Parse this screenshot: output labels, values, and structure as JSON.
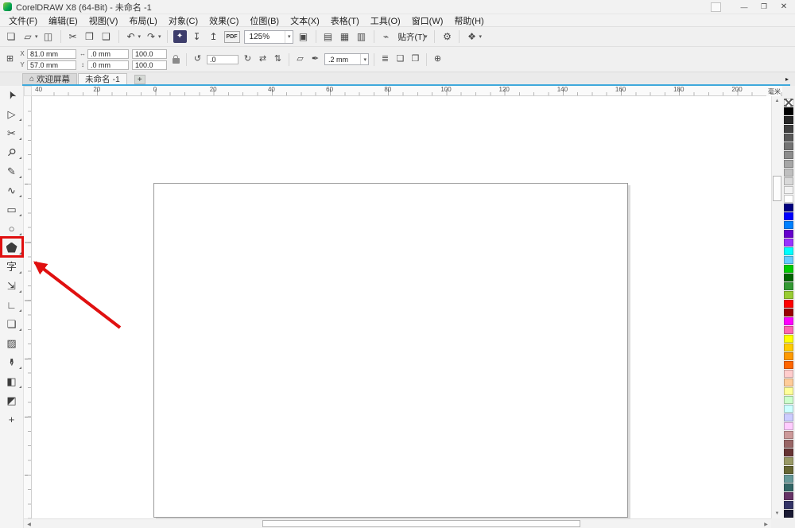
{
  "titlebar": {
    "title": "CorelDRAW X8 (64-Bit) - 未命名 -1",
    "window_buttons": {
      "minimize": "—",
      "restore": "❐",
      "close": "✕"
    }
  },
  "menubar": {
    "items": [
      "文件(F)",
      "编辑(E)",
      "视图(V)",
      "布局(L)",
      "对象(C)",
      "效果(C)",
      "位图(B)",
      "文本(X)",
      "表格(T)",
      "工具(O)",
      "窗口(W)",
      "帮助(H)"
    ]
  },
  "toolbar": {
    "zoom_level": "125%",
    "pdf_label": "PDF",
    "snap_label": "贴齐(T)",
    "icons": {
      "new": "❏",
      "open": "▱",
      "save": "◫",
      "cut": "✂",
      "copy": "❒",
      "paste": "❑",
      "undo": "↶",
      "redo": "↷",
      "search": "✦",
      "import": "↧",
      "export": "↥",
      "fullscreen": "▣",
      "rulers": "▤",
      "grid": "▦",
      "guidelines": "▥",
      "snap": "⌁",
      "gear": "⚙",
      "launcher": "❖",
      "caret": "▾"
    }
  },
  "property_bar": {
    "position_x": "81.0 mm",
    "position_y": "57.0 mm",
    "size_w": ".0 mm",
    "size_h": ".0 mm",
    "scale_h": "100.0",
    "scale_v": "100.0",
    "rotation": ".0",
    "outline_width": ".2 mm",
    "icons": {
      "grid": "⊞",
      "label_x": "X",
      "label_y": "Y",
      "width": "↔",
      "height": "↕",
      "rotate": "↺",
      "dial": "↻",
      "mirror_h": "⇄",
      "mirror_v": "⇅",
      "shape": "▱",
      "pen": "✒",
      "wrap": "≣",
      "front": "❏",
      "back": "❐",
      "plus": "⊕",
      "caret": "▾"
    }
  },
  "tabbar": {
    "tabs": [
      {
        "name": "tab-welcome",
        "label": "欢迎屏幕",
        "icon": "⌂",
        "active": false
      },
      {
        "name": "tab-untitled-1",
        "label": "未命名 -1",
        "active": true
      }
    ],
    "new_tab_label": "+",
    "scroll_arrow": "▸"
  },
  "rulers": {
    "horizontal_labels": [
      "40",
      "20",
      "0",
      "20",
      "40",
      "60",
      "80",
      "100",
      "120",
      "140",
      "160",
      "180",
      "200"
    ],
    "unit": "毫米"
  },
  "toolbox": {
    "tools": [
      {
        "name": "pick-tool",
        "glyph": "➤",
        "cls": "rot-up",
        "flyout": false
      },
      {
        "name": "shape-tool",
        "glyph": "▷",
        "flyout": true
      },
      {
        "name": "crop-tool",
        "glyph": "✂",
        "flyout": true
      },
      {
        "name": "zoom-tool",
        "glyph": "⚲",
        "cls": "rot45",
        "flyout": true
      },
      {
        "name": "freehand-tool",
        "glyph": "✎",
        "flyout": true
      },
      {
        "name": "artistic-media-tool",
        "glyph": "∿",
        "flyout": true
      },
      {
        "name": "rectangle-tool",
        "glyph": "▭",
        "flyout": true
      },
      {
        "name": "ellipse-tool",
        "glyph": "○",
        "flyout": true
      },
      {
        "name": "polygon-tool",
        "shape": "pentagon",
        "flyout": true
      },
      {
        "name": "text-tool",
        "glyph": "字",
        "flyout": true
      },
      {
        "name": "parallel-dimension-tool",
        "glyph": "⇲",
        "flyout": true
      },
      {
        "name": "connector-tool",
        "glyph": "∟",
        "flyout": true
      },
      {
        "name": "drop-shadow-tool",
        "glyph": "❏",
        "flyout": true
      },
      {
        "name": "transparency-tool",
        "glyph": "▨",
        "flyout": false
      },
      {
        "name": "color-eyedropper-tool",
        "glyph": "✒",
        "cls": "rot90",
        "flyout": true
      },
      {
        "name": "interactive-fill-tool",
        "glyph": "◧",
        "flyout": true
      },
      {
        "name": "smart-fill-tool",
        "glyph": "◩",
        "flyout": false
      },
      {
        "name": "add-tools-button",
        "glyph": "+",
        "flyout": false
      }
    ]
  },
  "palette": {
    "colors": [
      "none",
      "#000000",
      "#262626",
      "#404040",
      "#595959",
      "#737373",
      "#8c8c8c",
      "#a6a6a6",
      "#bfbfbf",
      "#d9d9d9",
      "#f2f2f2",
      "#ffffff",
      "#000080",
      "#0000ff",
      "#0080ff",
      "#6600cc",
      "#9933ff",
      "#00ffff",
      "#66ccff",
      "#00cc00",
      "#006600",
      "#339933",
      "#99cc33",
      "#ff0000",
      "#990000",
      "#ff00ff",
      "#ff66b3",
      "#ffff00",
      "#ffcc00",
      "#ff9900",
      "#ff6600",
      "#ffcccc",
      "#ffcc99",
      "#ffff99",
      "#ccffcc",
      "#ccffff",
      "#ccccff",
      "#ffccff",
      "#cc9999",
      "#996666",
      "#663333",
      "#999966",
      "#666633",
      "#669999",
      "#336666",
      "#663366",
      "#333366",
      "#1a1a33"
    ]
  },
  "scrollbars": {
    "up": "▲",
    "down": "▼",
    "left": "◀",
    "right": "▶"
  },
  "annotation": {
    "color": "#e01010",
    "highlighted_tool": "polygon-tool"
  }
}
